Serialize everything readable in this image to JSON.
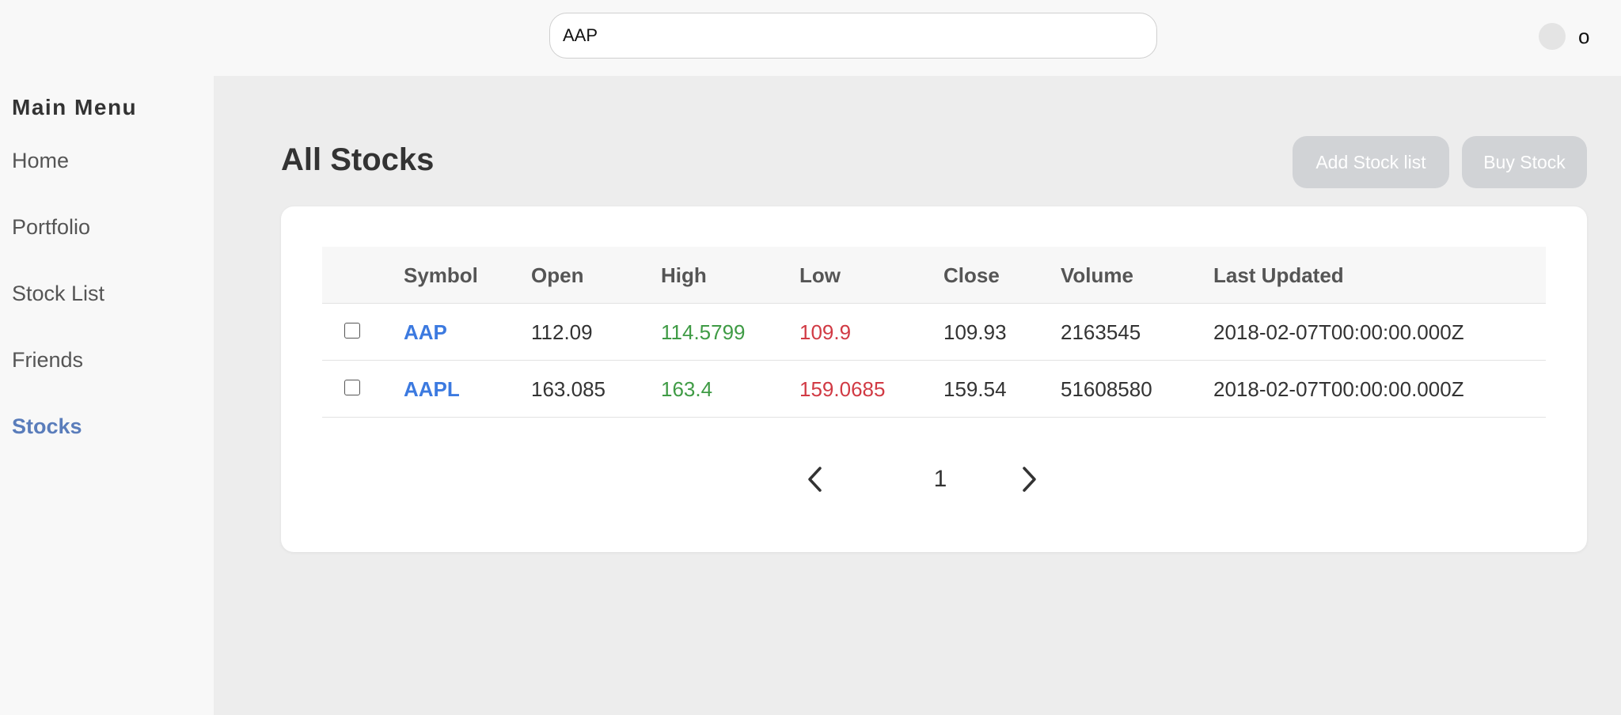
{
  "header": {
    "search_value": "AAP",
    "user_initial": "o"
  },
  "sidebar": {
    "title": "Main Menu",
    "items": [
      {
        "label": "Home"
      },
      {
        "label": "Portfolio"
      },
      {
        "label": "Stock List"
      },
      {
        "label": "Friends"
      },
      {
        "label": "Stocks"
      }
    ]
  },
  "main": {
    "title": "All Stocks",
    "add_stock_list_label": "Add Stock list",
    "buy_stock_label": "Buy Stock",
    "table": {
      "columns": [
        "Symbol",
        "Open",
        "High",
        "Low",
        "Close",
        "Volume",
        "Last Updated"
      ],
      "rows": [
        {
          "symbol": "AAP",
          "open": "112.09",
          "high": "114.5799",
          "low": "109.9",
          "close": "109.93",
          "volume": "2163545",
          "last_updated": "2018-02-07T00:00:00.000Z"
        },
        {
          "symbol": "AAPL",
          "open": "163.085",
          "high": "163.4",
          "low": "159.0685",
          "close": "159.54",
          "volume": "51608580",
          "last_updated": "2018-02-07T00:00:00.000Z"
        }
      ]
    },
    "pagination": {
      "current_page": "1"
    }
  },
  "colors": {
    "active_menu": "#5a7dbb",
    "symbol_link": "#3c7ae0",
    "high": "#3f9b45",
    "low": "#d13a44",
    "button_disabled": "#d1d3d6"
  }
}
